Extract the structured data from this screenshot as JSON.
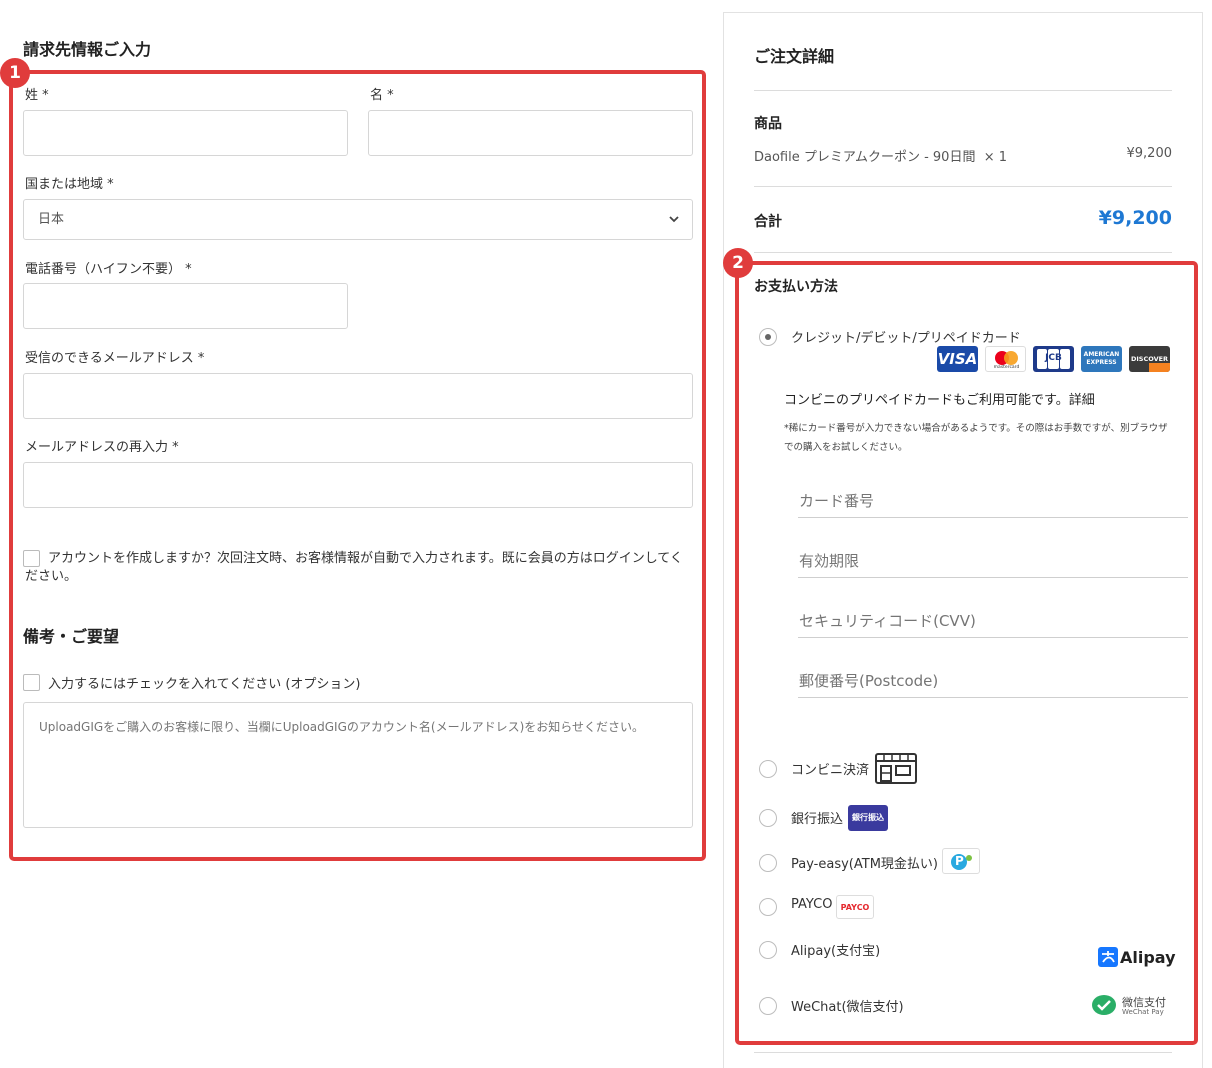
{
  "billing": {
    "title": "請求先情報ご入力",
    "last_name_label": "姓 *",
    "first_name_label": "名 *",
    "country_label": "国または地域 *",
    "country_value": "日本",
    "phone_label": "電話番号（ハイフン不要） *",
    "email_label": "受信のできるメールアドレス *",
    "email_confirm_label": "メールアドレスの再入力 *",
    "create_account_text": "アカウントを作成しますか？次回注文時、お客様情報が自動で入力されます。既に会員の方はログインしてください。"
  },
  "notes": {
    "title": "備考・ご要望",
    "checkbox_label": "入力するにはチェックを入れてください (オプション)",
    "placeholder": "UploadGIGをご購入のお客様に限り、当欄にUploadGIGのアカウント名(メールアドレス)をお知らせください。"
  },
  "order": {
    "title": "ご注文詳細",
    "product_header": "商品",
    "product_name": "Daofile プレミアムクーポン - 90日間  × 1",
    "product_price": "¥9,200",
    "total_label": "合計",
    "total_amount": "¥9,200"
  },
  "payment": {
    "title": "お支払い方法",
    "credit_label": "クレジット/デビット/プリペイドカード",
    "credit_note": "コンビニのプリペイドカードもご利用可能です。詳細",
    "credit_small_note": "*稀にカード番号が入力できない場合があるようです。その際はお手数ですが、別ブラウザでの購入をお試しください。",
    "card_number_placeholder": "カード番号",
    "expiry_placeholder": "有効期限",
    "cvv_placeholder": "セキュリティコード(CVV)",
    "postcode_placeholder": "郵便番号(Postcode)",
    "cards": {
      "visa": "VISA",
      "mastercard_sub": "mastercard",
      "jcb": "JCB",
      "amex_top": "AMERICAN",
      "amex_bottom": "EXPRESS",
      "discover": "DISCOVER"
    },
    "methods": [
      {
        "label": "コンビニ決済",
        "icon": "convenience-store-icon"
      },
      {
        "label": "銀行振込",
        "icon": "bank-transfer-icon",
        "icon_text": "銀行振込"
      },
      {
        "label": "Pay-easy(ATM現金払い)",
        "icon": "payeasy-icon",
        "icon_text": "P"
      },
      {
        "label": "PAYCO",
        "icon": "payco-icon",
        "icon_text": "PAYCO"
      },
      {
        "label": "Alipay(支付宝)",
        "icon": "alipay-icon",
        "icon_text": "Alipay"
      },
      {
        "label": "WeChat(微信支付)",
        "icon": "wechat-pay-icon",
        "icon_text": "微信支付",
        "icon_subtext": "WeChat Pay"
      }
    ]
  },
  "annotations": {
    "badge1": "1",
    "badge2": "2"
  },
  "colors": {
    "highlight": "#e03c3c",
    "total": "#1e78d3",
    "bank_badge": "#3a3a9e",
    "alipay": "#1677ff",
    "wechat": "#2aae67"
  }
}
